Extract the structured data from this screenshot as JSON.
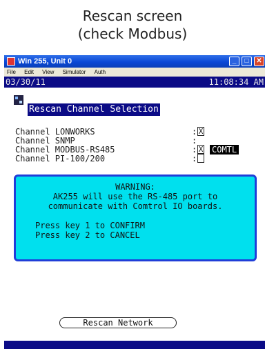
{
  "caption": {
    "line1": "Rescan screen",
    "line2": "(check Modbus)"
  },
  "window": {
    "title": "Win 255, Unit 0",
    "menu": [
      "File",
      "Edit",
      "View",
      "Simulator",
      "Auth"
    ],
    "date": "03/30/11",
    "time": "11:08:34 AM",
    "heading": "Rescan Channel Selection"
  },
  "channels": [
    {
      "label": "Channel LONWORKS",
      "checked": "X"
    },
    {
      "label": "Channel SNMP",
      "checked": ""
    },
    {
      "label": "Channel MODBUS-RS485",
      "checked": "X",
      "protocol": "COMTL"
    },
    {
      "label": "Channel PI-100/200",
      "checked": ""
    }
  ],
  "colon": ":",
  "warning": {
    "title": "WARNING:",
    "line1": "AK255 will use the RS-485 port to",
    "line2": "communicate with Comtrol IO boards.",
    "confirm": "Press key 1 to CONFIRM",
    "cancel": "Press key 2 to CANCEL"
  },
  "rescan_button": "Rescan Network",
  "colors": {
    "titlebar": "#0a48d6",
    "datebar": "#0b0b86",
    "dialog_bg": "#00e0ee",
    "dialog_border": "#1f3ed8"
  }
}
